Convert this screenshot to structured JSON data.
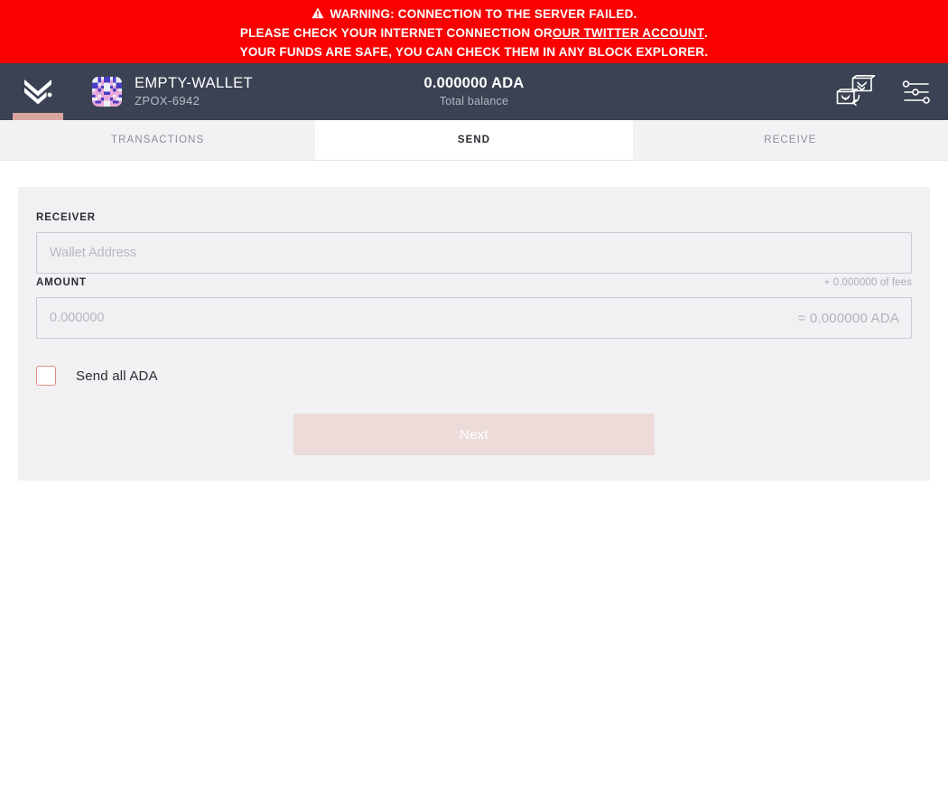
{
  "warning": {
    "icon": "warning-triangle-icon",
    "line1": "WARNING: CONNECTION TO THE SERVER FAILED.",
    "line2_prefix": "PLEASE CHECK YOUR INTERNET CONNECTION OR ",
    "line2_link": "OUR TWITTER ACCOUNT",
    "line2_suffix": ".",
    "line3": "YOUR FUNDS ARE SAFE, YOU CAN CHECK THEM IN ANY BLOCK EXPLORER.",
    "background_color": "#fa0000",
    "text_color": "#ffffff"
  },
  "topbar": {
    "logo_icon": "daedalus-chevron-logo-icon",
    "indicator_color": "#daa5a0",
    "wallet": {
      "avatar_icon": "wallet-identicon-avatar",
      "name": "EMPTY-WALLET",
      "id": "ZPOX-6942"
    },
    "balance": {
      "amount": "0.000000 ADA",
      "label": "Total balance"
    },
    "actions": [
      {
        "icon": "wallet-switch-icon",
        "name": "switch-wallet-button"
      },
      {
        "icon": "settings-sliders-icon",
        "name": "settings-button"
      }
    ],
    "background_color": "#3a4253"
  },
  "tabs": [
    {
      "id": "transactions",
      "label": "TRANSACTIONS",
      "active": false
    },
    {
      "id": "send",
      "label": "SEND",
      "active": true
    },
    {
      "id": "receive",
      "label": "RECEIVE",
      "active": false
    }
  ],
  "send_form": {
    "receiver": {
      "label": "RECEIVER",
      "value": "",
      "placeholder": "Wallet Address"
    },
    "amount": {
      "label": "AMOUNT",
      "value": "",
      "placeholder": "0.000000",
      "fees_note": "+ 0.000000 of fees",
      "converted": "= 0.000000 ADA"
    },
    "send_all": {
      "label": "Send all ADA",
      "checked": false,
      "border_color": "#e08c82"
    },
    "next_button": {
      "label": "Next",
      "disabled": true,
      "background_color": "#ecdbd9"
    }
  }
}
